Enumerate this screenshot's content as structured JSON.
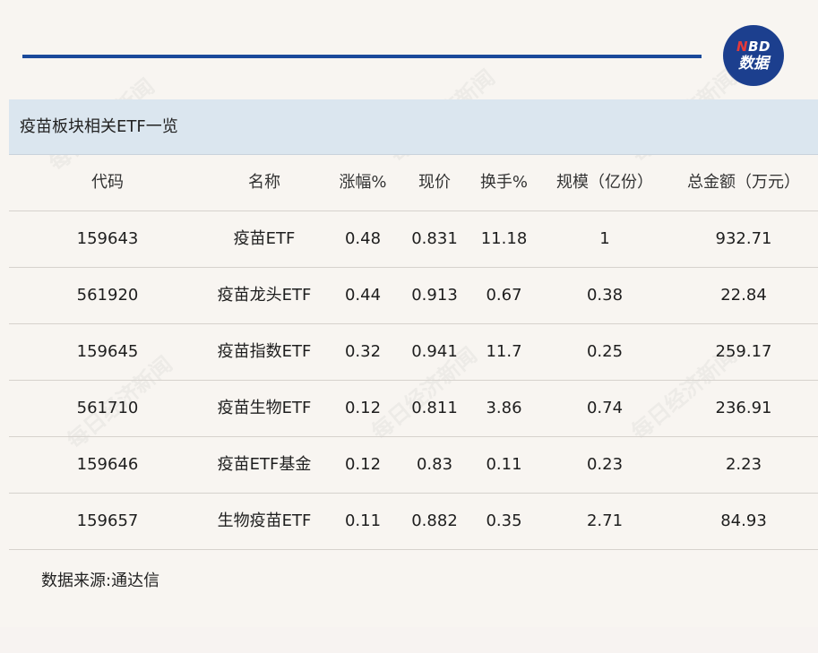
{
  "logo": {
    "line1_letter1": "N",
    "line1_rest": "BD",
    "line2": "数据"
  },
  "table": {
    "title": "疫苗板块相关ETF一览",
    "headers": [
      "代码",
      "名称",
      "涨幅%",
      "现价",
      "换手%",
      "规模（亿份）",
      "总金额（万元）"
    ],
    "rows": [
      [
        "159643",
        "疫苗ETF",
        "0.48",
        "0.831",
        "11.18",
        "1",
        "932.71"
      ],
      [
        "561920",
        "疫苗龙头ETF",
        "0.44",
        "0.913",
        "0.67",
        "0.38",
        "22.84"
      ],
      [
        "159645",
        "疫苗指数ETF",
        "0.32",
        "0.941",
        "11.7",
        "0.25",
        "259.17"
      ],
      [
        "561710",
        "疫苗生物ETF",
        "0.12",
        "0.811",
        "3.86",
        "0.74",
        "236.91"
      ],
      [
        "159646",
        "疫苗ETF基金",
        "0.12",
        "0.83",
        "0.11",
        "0.23",
        "2.23"
      ],
      [
        "159657",
        "生物疫苗ETF",
        "0.11",
        "0.882",
        "0.35",
        "2.71",
        "84.93"
      ]
    ]
  },
  "source": "数据来源:通达信",
  "watermark_text": "每日经济新闻",
  "colors": {
    "accent_line": "#1b4a9b",
    "logo_bg": "#1c3f8e",
    "logo_red": "#e63a3a",
    "header_bar": "#dbe6ef",
    "background": "#f8f5f1"
  }
}
